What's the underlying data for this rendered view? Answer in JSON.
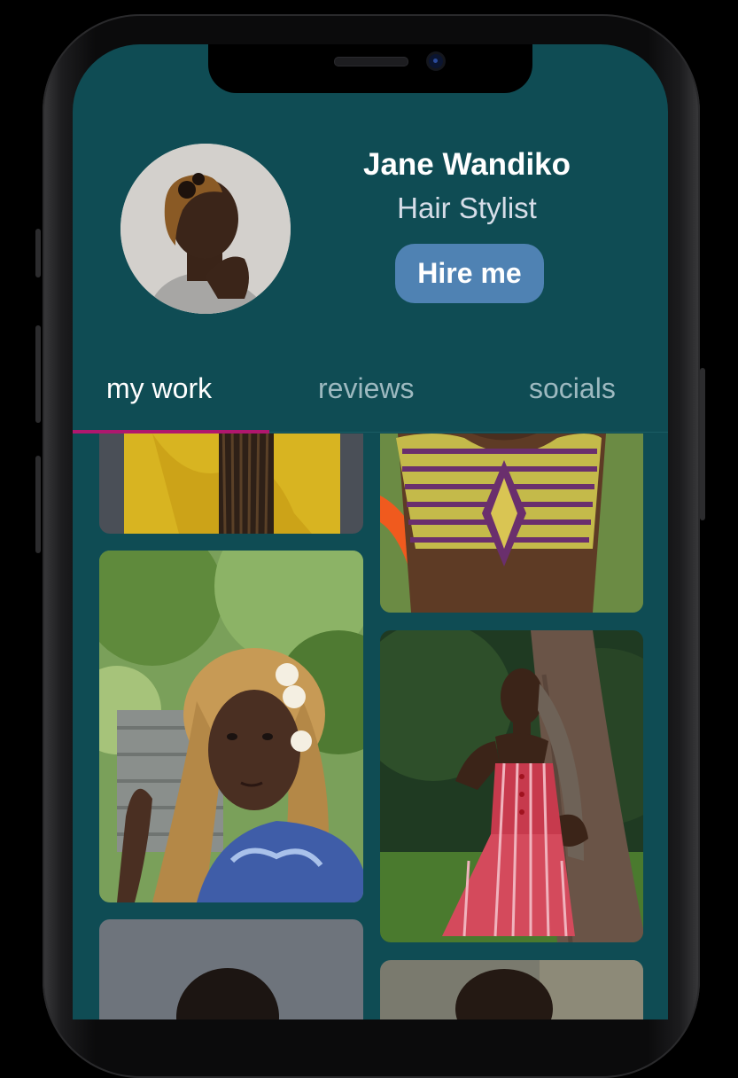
{
  "profile": {
    "name": "Jane Wandiko",
    "role": "Hair Stylist",
    "hire_label": "Hire me"
  },
  "tabs": [
    {
      "label": "my work",
      "active": true
    },
    {
      "label": "reviews",
      "active": false
    },
    {
      "label": "socials",
      "active": false
    }
  ],
  "colors": {
    "background": "#0f4c54",
    "accent_underline": "#b0176e",
    "button": "#4f82b3"
  },
  "gallery": [
    {
      "name": "yellow-top-braids-photo"
    },
    {
      "name": "patterned-dress-photo"
    },
    {
      "name": "braids-flowers-portrait-photo"
    },
    {
      "name": "striped-dress-tree-photo"
    },
    {
      "name": "grey-portrait-photo"
    },
    {
      "name": "outdoor-portrait-photo"
    }
  ]
}
